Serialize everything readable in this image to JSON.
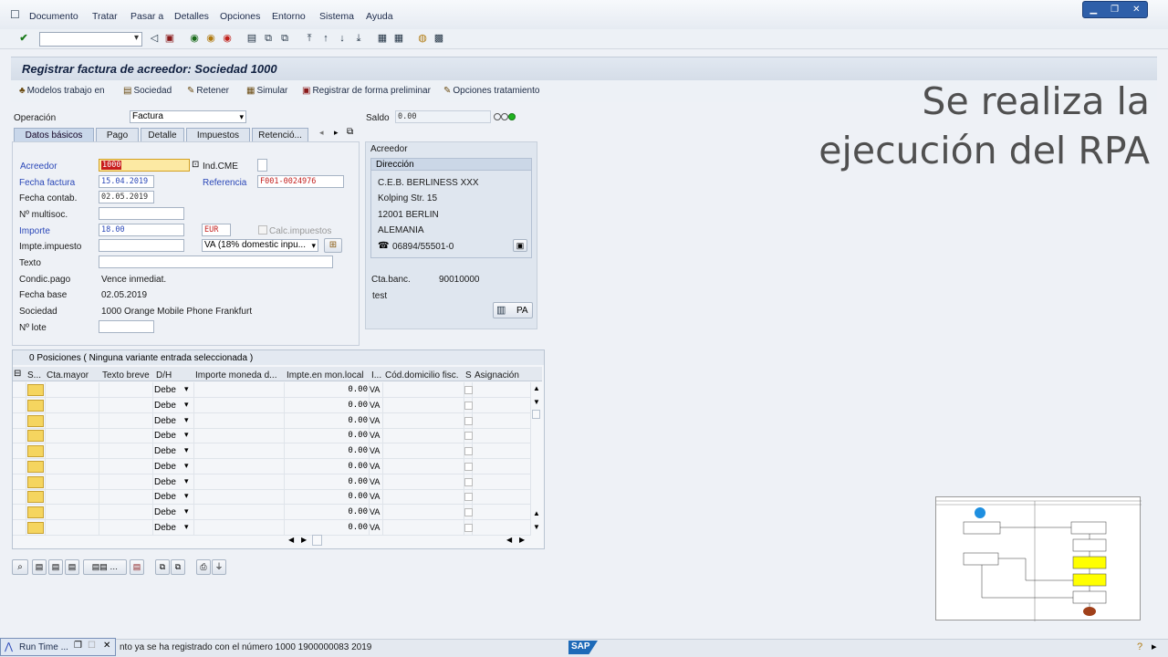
{
  "menu": [
    "Documento",
    "Tratar",
    "Pasar a",
    "Detalles",
    "Opciones",
    "Entorno",
    "Sistema",
    "Ayuda"
  ],
  "title": "Registrar factura de acreedor: Sociedad 1000",
  "app_toolbar": {
    "modelos": "Modelos trabajo en",
    "sociedad": "Sociedad",
    "retener": "Retener",
    "simular": "Simular",
    "preliminar": "Registrar de forma preliminar",
    "opciones": "Opciones tratamiento"
  },
  "operacion": {
    "label": "Operación",
    "value": "Factura"
  },
  "saldo": {
    "label": "Saldo",
    "value": "0.00"
  },
  "tabs": [
    "Datos básicos",
    "Pago",
    "Detalle",
    "Impuestos",
    "Retenció..."
  ],
  "form": {
    "acreedor_label": "Acreedor",
    "acreedor_value": "1000",
    "indcme_label": "Ind.CME",
    "fecha_factura_label": "Fecha factura",
    "fecha_factura_value": "15.04.2019",
    "referencia_label": "Referencia",
    "referencia_value": "F001-0024976",
    "fecha_contab_label": "Fecha contab.",
    "fecha_contab_value": "02.05.2019",
    "multisoc_label": "Nº multisoc.",
    "importe_label": "Importe",
    "importe_value": "18.00",
    "currency": "EUR",
    "calc_label": "Calc.impuestos",
    "impte_label": "Impte.impuesto",
    "impte_select": "VA (18% domestic inpu...",
    "texto_label": "Texto",
    "condic_label": "Condic.pago",
    "condic_value": "Vence inmediat.",
    "fecha_base_label": "Fecha base",
    "fecha_base_value": "02.05.2019",
    "sociedad_label": "Sociedad",
    "sociedad_value": "1000 Orange Mobile Phone Frankfurt",
    "lote_label": "Nº lote"
  },
  "vendor": {
    "header": "Acreedor",
    "dir_header": "Dirección",
    "name": "C.E.B. BERLINESS XXX",
    "street": "Kolping Str. 15",
    "city": "12001 BERLIN",
    "country": "ALEMANIA",
    "phone": "06894/55501-0",
    "ctabanc_label": "Cta.banc.",
    "ctabanc_value": "90010000",
    "note": "test",
    "pa_label": "PA"
  },
  "positions": {
    "title": "0 Posiciones ( Ninguna variante entrada seleccionada )",
    "columns": [
      "S...",
      "Cta.mayor",
      "Texto breve",
      "D/H",
      "Importe moneda d...",
      "Impte.en mon.local",
      "I...",
      "Cód.domicilio fisc.",
      "S",
      "Asignación"
    ],
    "rows": [
      {
        "dh": "Debe",
        "amount": "0.00",
        "tax": "VA"
      },
      {
        "dh": "Debe",
        "amount": "0.00",
        "tax": "VA"
      },
      {
        "dh": "Debe",
        "amount": "0.00",
        "tax": "VA"
      },
      {
        "dh": "Debe",
        "amount": "0.00",
        "tax": "VA"
      },
      {
        "dh": "Debe",
        "amount": "0.00",
        "tax": "VA"
      },
      {
        "dh": "Debe",
        "amount": "0.00",
        "tax": "VA"
      },
      {
        "dh": "Debe",
        "amount": "0.00",
        "tax": "VA"
      },
      {
        "dh": "Debe",
        "amount": "0.00",
        "tax": "VA"
      },
      {
        "dh": "Debe",
        "amount": "0.00",
        "tax": "VA"
      },
      {
        "dh": "Debe",
        "amount": "0.00",
        "tax": "VA"
      }
    ]
  },
  "status": {
    "message": "nto ya se ha registrado con el número 1000 1900000083 2019",
    "runtime": "Run Time ...",
    "sap_logo": "SAP"
  },
  "overlay_lines": [
    "Se  realiza la",
    "ejecución del RPA"
  ],
  "colors": {
    "accent": "#2b48b8",
    "required_field": "#fce9a3",
    "row_selector": "#f5d55f"
  }
}
